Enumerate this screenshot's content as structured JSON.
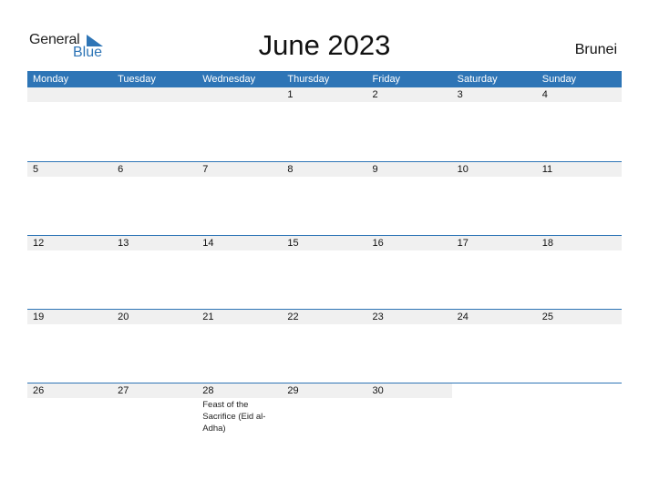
{
  "logo": {
    "general": "General",
    "blue": "Blue"
  },
  "title": "June 2023",
  "country": "Brunei",
  "colors": {
    "accent": "#2e75b6",
    "row_bg": "#f0f0f0"
  },
  "weekdays": [
    "Monday",
    "Tuesday",
    "Wednesday",
    "Thursday",
    "Friday",
    "Saturday",
    "Sunday"
  ],
  "weeks": [
    {
      "days": [
        "",
        "",
        "",
        "1",
        "2",
        "3",
        "4"
      ],
      "events": [
        "",
        "",
        "",
        "",
        "",
        "",
        ""
      ]
    },
    {
      "days": [
        "5",
        "6",
        "7",
        "8",
        "9",
        "10",
        "11"
      ],
      "events": [
        "",
        "",
        "",
        "",
        "",
        "",
        ""
      ]
    },
    {
      "days": [
        "12",
        "13",
        "14",
        "15",
        "16",
        "17",
        "18"
      ],
      "events": [
        "",
        "",
        "",
        "",
        "",
        "",
        ""
      ]
    },
    {
      "days": [
        "19",
        "20",
        "21",
        "22",
        "23",
        "24",
        "25"
      ],
      "events": [
        "",
        "",
        "",
        "",
        "",
        "",
        ""
      ]
    },
    {
      "days": [
        "26",
        "27",
        "28",
        "29",
        "30",
        "",
        ""
      ],
      "events": [
        "",
        "",
        "Feast of the Sacrifice (Eid al-Adha)",
        "",
        "",
        "",
        ""
      ]
    }
  ]
}
